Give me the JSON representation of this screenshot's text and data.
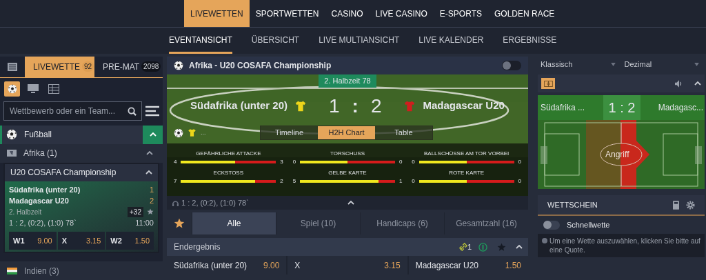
{
  "top_nav": [
    {
      "label": "LIVEWETTEN",
      "selected": true
    },
    {
      "label": "SPORTWETTEN",
      "selected": false
    },
    {
      "label": "CASINO",
      "selected": false
    },
    {
      "label": "LIVE CASINO",
      "selected": false
    },
    {
      "label": "E-SPORTS",
      "selected": false
    },
    {
      "label": "GOLDEN RACE",
      "selected": false
    }
  ],
  "sub_nav": [
    {
      "label": "EVENTANSICHT",
      "selected": true
    },
    {
      "label": "ÜBERSICHT",
      "selected": false
    },
    {
      "label": "LIVE MULTIANSICHT",
      "selected": false
    },
    {
      "label": "LIVE KALENDER",
      "selected": false
    },
    {
      "label": "ERGEBNISSE",
      "selected": false
    }
  ],
  "left": {
    "tabs": [
      {
        "label": "LIVEWETTE",
        "count": "92",
        "selected": true
      },
      {
        "label": "PRE-MAT",
        "count": "2098",
        "selected": false
      }
    ],
    "filters": [
      {
        "kind": "ball",
        "selected": true
      },
      {
        "kind": "screen",
        "selected": false
      },
      {
        "kind": "grid",
        "selected": false
      }
    ],
    "search": {
      "placeholder": "Wettbewerb oder ein Team..."
    },
    "sport": {
      "name": "Fußball",
      "expanded": true
    },
    "region": {
      "name": "Afrika (1)",
      "expanded": true
    },
    "competition": {
      "name": "U20 COSAFA Championship",
      "expanded": true
    },
    "match": {
      "home": "Südafrika (unter 20)",
      "away": "Madagascar U20",
      "home_score": "1",
      "away_score": "2",
      "period": "2. Halbzeit",
      "more": "+32",
      "detail": "1 : 2, (0:2), (1:0) 78`",
      "time": "11:00",
      "odds": [
        {
          "label": "W1",
          "value": "9.00"
        },
        {
          "label": "X",
          "value": "3.15"
        },
        {
          "label": "W2",
          "value": "1.50"
        }
      ]
    },
    "next_region": {
      "name": "Indien (3)"
    }
  },
  "center": {
    "title": "Afrika - U20 COSAFA Championship",
    "toggle_on": false,
    "period_badge": "2. Halbzeit 78",
    "home": "Südafrika (unter 20)",
    "away": "Madagascar U20",
    "score_home": "1",
    "separator": ":",
    "score_away": "2",
    "dots": "...",
    "view_tabs": [
      {
        "label": "Timeline",
        "selected": false
      },
      {
        "label": "H2H Chart",
        "selected": true
      },
      {
        "label": "Table",
        "selected": false
      }
    ],
    "stats": [
      {
        "label": "GEFÄHRLICHE ATTACKE",
        "home": "4",
        "away": "3",
        "level": 0.57
      },
      {
        "label": "TORSCHUSS",
        "home": "0",
        "away": "0",
        "level": 0.5
      },
      {
        "label": "BALLSCHÜSSE AM TOR VORBEI",
        "home": "0",
        "away": "0",
        "level": 0.5
      },
      {
        "label": "ECKSTOSS",
        "home": "7",
        "away": "2",
        "level": 0.78
      },
      {
        "label": "GELBE KARTE",
        "home": "5",
        "away": "1",
        "level": 0.83
      },
      {
        "label": "ROTE KARTE",
        "home": "0",
        "away": "0",
        "level": 0.5
      }
    ],
    "event_info": "1 : 2, (0:2), (1:0) 78`",
    "market_tabs": [
      {
        "label": "Alle",
        "selected": true
      },
      {
        "label": "Spiel (10)",
        "selected": false
      },
      {
        "label": "Handicaps (6)",
        "selected": false
      },
      {
        "label": "Gesamtzahl (16)",
        "selected": false
      }
    ],
    "market": {
      "title": "Endergebnis",
      "link_count": "1",
      "expanded": true,
      "odds": [
        {
          "label": "Südafrika (unter 20)",
          "value": "9.00"
        },
        {
          "label": "X",
          "value": "3.15"
        },
        {
          "label": "Madagascar U20",
          "value": "1.50"
        }
      ]
    }
  },
  "right": {
    "selects": [
      "Klassisch",
      "Dezimal"
    ],
    "tracker": {
      "home": "Südafrika ...",
      "score": "1 : 2",
      "away": "Madagasc...",
      "action": "Angriff"
    },
    "betslip": {
      "title": "WETTSCHEIN",
      "quick_bet": {
        "label": "Schnellwette",
        "on": false
      },
      "hint": "Um eine Wette auszuwählen, klicken Sie bitte auf eine Quote."
    }
  }
}
